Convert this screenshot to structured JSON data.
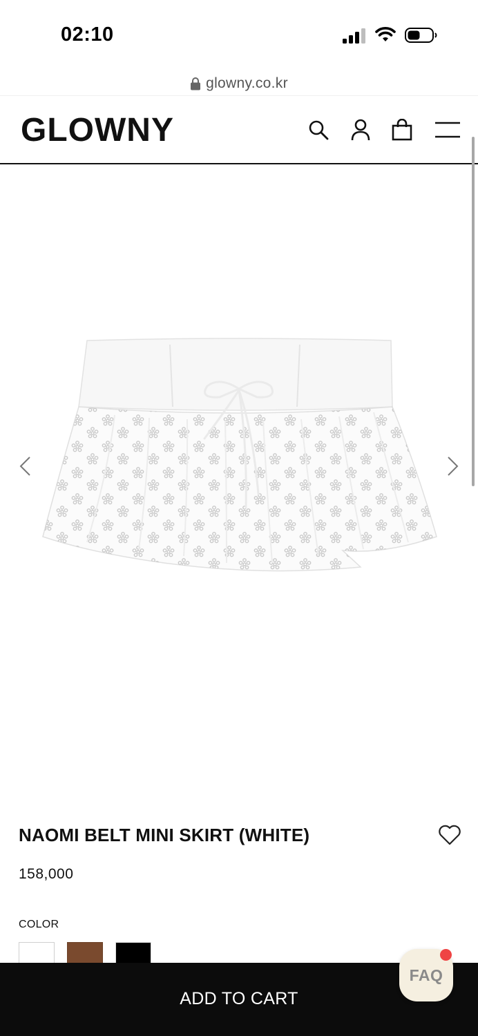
{
  "status_bar": {
    "time": "02:10"
  },
  "browser": {
    "url": "glowny.co.kr"
  },
  "header": {
    "logo": "GLOWNY",
    "icons": [
      "search-icon",
      "user-icon",
      "shopping-bag-icon",
      "menu-icon"
    ]
  },
  "product": {
    "title": "NAOMI BELT MINI SKIRT (WHITE)",
    "price": "158,000",
    "color_label": "COLOR",
    "swatches": [
      {
        "name": "white",
        "color": "#ffffff"
      },
      {
        "name": "brown",
        "color": "#7a4a2e"
      },
      {
        "name": "black",
        "color": "#000000"
      }
    ]
  },
  "actions": {
    "add_to_cart": "ADD TO CART",
    "faq": "FAQ"
  },
  "colors": {
    "cart_bar": "#0c0c0c",
    "faq_bg": "#f5efe0",
    "faq_dot": "#ef4444"
  }
}
